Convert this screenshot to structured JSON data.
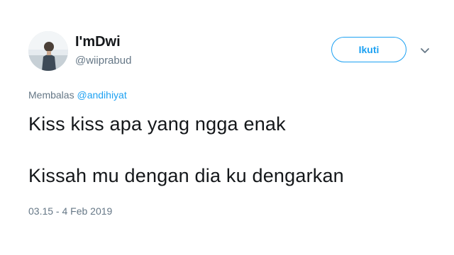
{
  "user": {
    "display_name": "I'mDwi",
    "handle": "@wiiprabud",
    "avatar_icon": "profile-photo-avatar"
  },
  "follow_button": {
    "label": "Ikuti",
    "color": "#1da1f2"
  },
  "menu": {
    "icon": "chevron-down-icon"
  },
  "reply": {
    "prefix": "Membalas",
    "mention": "@andihiyat"
  },
  "tweet": {
    "lines": [
      "Kiss kiss apa yang ngga enak",
      "Kissah mu dengan dia ku dengarkan"
    ],
    "timestamp": "03.15 - 4 Feb 2019"
  }
}
